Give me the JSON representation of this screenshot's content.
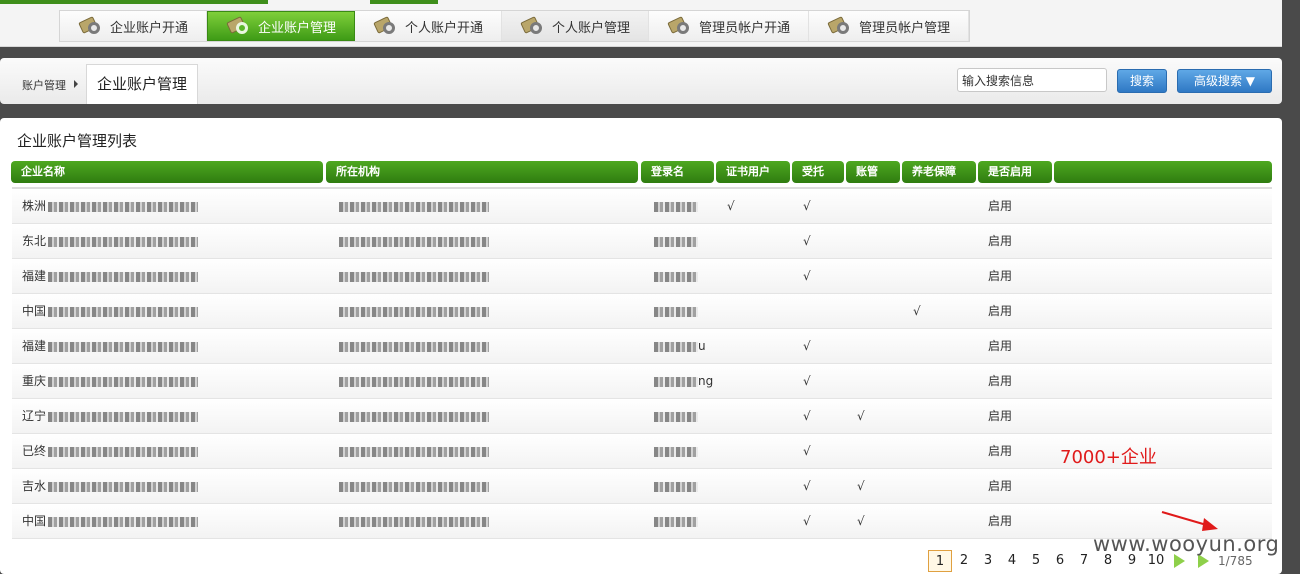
{
  "tabs": [
    {
      "label": "企业账户开通",
      "icon": "card-key-icon",
      "active": false
    },
    {
      "label": "企业账户管理",
      "icon": "card-key-icon",
      "active": true
    },
    {
      "label": "个人账户开通",
      "icon": "card-key-icon",
      "active": false
    },
    {
      "label": "个人账户管理",
      "icon": "card-key-icon",
      "active": false
    },
    {
      "label": "管理员帐户开通",
      "icon": "card-key-icon",
      "active": false
    },
    {
      "label": "管理员帐户管理",
      "icon": "card-key-icon",
      "active": false
    }
  ],
  "breadcrumb": {
    "root": "账户管理",
    "current": "企业账户管理"
  },
  "search": {
    "value": "输入搜索信息",
    "search_label": "搜索",
    "advanced_label": "高级搜索 ▼"
  },
  "list": {
    "title": "企业账户管理列表",
    "columns": [
      "企业名称",
      "所在机构",
      "登录名",
      "证书用户",
      "受托",
      "账管",
      "养老保障",
      "是否启用"
    ],
    "rows": [
      {
        "name": "株洲",
        "org": "",
        "login": "",
        "cert": "√",
        "trust": "√",
        "acct": "",
        "pension": "",
        "enabled": "启用"
      },
      {
        "name": "东北",
        "org": "",
        "login": "",
        "cert": "",
        "trust": "√",
        "acct": "",
        "pension": "",
        "enabled": "启用"
      },
      {
        "name": "福建",
        "org": "",
        "login": "",
        "cert": "",
        "trust": "√",
        "acct": "",
        "pension": "",
        "enabled": "启用"
      },
      {
        "name": "中国",
        "org": "",
        "login": "",
        "cert": "",
        "trust": "",
        "acct": "",
        "pension": "√",
        "enabled": "启用"
      },
      {
        "name": "福建",
        "org": "",
        "login": "u",
        "cert": "",
        "trust": "√",
        "acct": "",
        "pension": "",
        "enabled": "启用"
      },
      {
        "name": "重庆",
        "org": "",
        "login": "ng",
        "cert": "",
        "trust": "√",
        "acct": "",
        "pension": "",
        "enabled": "启用"
      },
      {
        "name": "辽宁",
        "org": "",
        "login": "",
        "cert": "",
        "trust": "√",
        "acct": "√",
        "pension": "",
        "enabled": "启用"
      },
      {
        "name": "已终",
        "org": "",
        "login": "",
        "cert": "",
        "trust": "√",
        "acct": "",
        "pension": "",
        "enabled": "启用"
      },
      {
        "name": "吉水",
        "org": "",
        "login": "",
        "cert": "",
        "trust": "√",
        "acct": "√",
        "pension": "",
        "enabled": "启用"
      },
      {
        "name": "中国",
        "org": "",
        "login": "",
        "cert": "",
        "trust": "√",
        "acct": "√",
        "pension": "",
        "enabled": "启用"
      }
    ]
  },
  "annotation": "7000+企业",
  "annotation_color": "#e01a1a",
  "pager": {
    "pages": [
      "1",
      "2",
      "3",
      "4",
      "5",
      "6",
      "7",
      "8",
      "9",
      "10"
    ],
    "current": "1",
    "total": "1/785"
  },
  "watermark": "www.wooyun.org",
  "accent_color": "#3e9b16"
}
